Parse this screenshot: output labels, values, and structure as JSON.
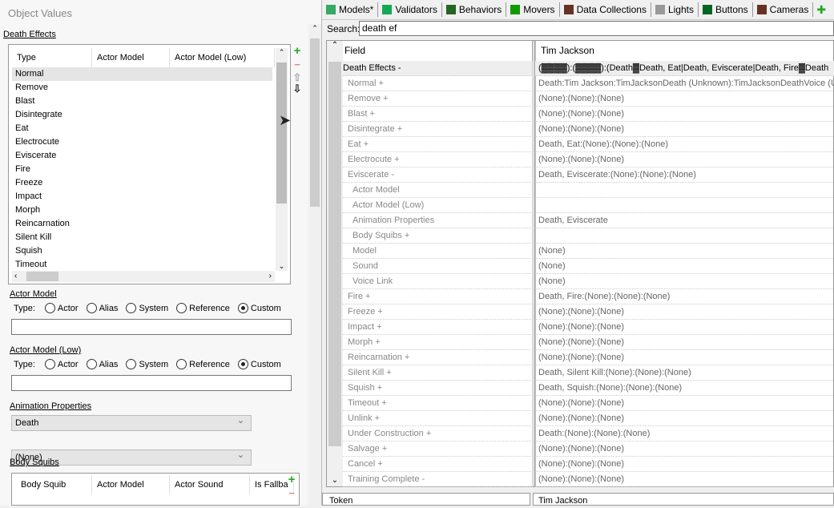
{
  "left": {
    "title": "Object Values",
    "death_effects_label": "Death Effects",
    "columns": [
      "Type",
      "Actor Model",
      "Actor Model (Low)"
    ],
    "types": [
      "Normal",
      "Remove",
      "Blast",
      "Disintegrate",
      "Eat",
      "Electrocute",
      "Eviscerate",
      "Fire",
      "Freeze",
      "Impact",
      "Morph",
      "Reincarnation",
      "Silent Kill",
      "Squish",
      "Timeout"
    ],
    "actor_model_label": "Actor Model",
    "actor_model_low_label": "Actor Model (Low)",
    "type_label": "Type:",
    "radio_options": [
      "Actor",
      "Alias",
      "System",
      "Reference",
      "Custom"
    ],
    "radio_selected": "Custom",
    "actor_model_value": "",
    "actor_model_low_value": "",
    "animation_properties_label": "Animation Properties",
    "anim_select_1": "Death",
    "anim_select_2": "(None)",
    "body_squibs_label": "Body Squibs",
    "squib_columns": [
      "Body Squib",
      "Actor Model",
      "Actor Sound",
      "Is Fallba"
    ]
  },
  "tabs": [
    "Models*",
    "Validators",
    "Behaviors",
    "Movers",
    "Data Collections",
    "Lights",
    "Buttons",
    "Cameras"
  ],
  "tab_icon_colors": [
    "#3a6",
    "#1a5",
    "#262",
    "#190",
    "#632",
    "#999",
    "#062",
    "#632"
  ],
  "search": {
    "label": "Search:",
    "value": "death ef"
  },
  "grid": {
    "field_header": "Field",
    "value_header": "Tim Jackson",
    "rows": [
      {
        "f": "Death Effects -",
        "v": "(▓▓▓▓):(▓▓▓▓):(Death▓Death, Eat|Death, Eviscerate|Death, Fire▓Death",
        "lvl": 0
      },
      {
        "f": "Normal +",
        "v": "Death:Tim Jackson:TimJacksonDeath (Unknown):TimJacksonDeathVoice (Un",
        "lvl": 1
      },
      {
        "f": "Remove +",
        "v": "(None):(None):(None)",
        "lvl": 1
      },
      {
        "f": "Blast +",
        "v": "(None):(None):(None)",
        "lvl": 1
      },
      {
        "f": "Disintegrate +",
        "v": "(None):(None):(None)",
        "lvl": 1
      },
      {
        "f": "Eat +",
        "v": "Death, Eat:(None):(None):(None)",
        "lvl": 1
      },
      {
        "f": "Electrocute +",
        "v": "(None):(None):(None)",
        "lvl": 1
      },
      {
        "f": "Eviscerate -",
        "v": "Death, Eviscerate:(None):(None):(None)",
        "lvl": 1
      },
      {
        "f": "Actor Model",
        "v": "",
        "lvl": 2
      },
      {
        "f": "Actor Model (Low)",
        "v": "",
        "lvl": 2
      },
      {
        "f": "Animation Properties",
        "v": "Death, Eviscerate",
        "lvl": 2
      },
      {
        "f": "Body Squibs +",
        "v": "",
        "lvl": 2
      },
      {
        "f": "Model",
        "v": "(None)",
        "lvl": 2
      },
      {
        "f": "Sound",
        "v": "(None)",
        "lvl": 2
      },
      {
        "f": "Voice Link",
        "v": "(None)",
        "lvl": 2
      },
      {
        "f": "Fire +",
        "v": "Death, Fire:(None):(None):(None)",
        "lvl": 1
      },
      {
        "f": "Freeze +",
        "v": "(None):(None):(None)",
        "lvl": 1
      },
      {
        "f": "Impact +",
        "v": "(None):(None):(None)",
        "lvl": 1
      },
      {
        "f": "Morph +",
        "v": "(None):(None):(None)",
        "lvl": 1
      },
      {
        "f": "Reincarnation +",
        "v": "(None):(None):(None)",
        "lvl": 1
      },
      {
        "f": "Silent Kill +",
        "v": "Death, Silent Kill:(None):(None):(None)",
        "lvl": 1
      },
      {
        "f": "Squish +",
        "v": "Death, Squish:(None):(None):(None)",
        "lvl": 1
      },
      {
        "f": "Timeout +",
        "v": "(None):(None):(None)",
        "lvl": 1
      },
      {
        "f": "Unlink +",
        "v": "(None):(None):(None)",
        "lvl": 1
      },
      {
        "f": "Under Construction +",
        "v": "Death:(None):(None):(None)",
        "lvl": 1
      },
      {
        "f": "Salvage +",
        "v": "(None):(None):(None)",
        "lvl": 1
      },
      {
        "f": "Cancel +",
        "v": "(None):(None):(None)",
        "lvl": 1
      },
      {
        "f": "Training Complete -",
        "v": "(None):(None):(None)",
        "lvl": 1
      }
    ]
  },
  "bottom": {
    "token_header": "Token",
    "value_header": "Tim Jackson"
  }
}
